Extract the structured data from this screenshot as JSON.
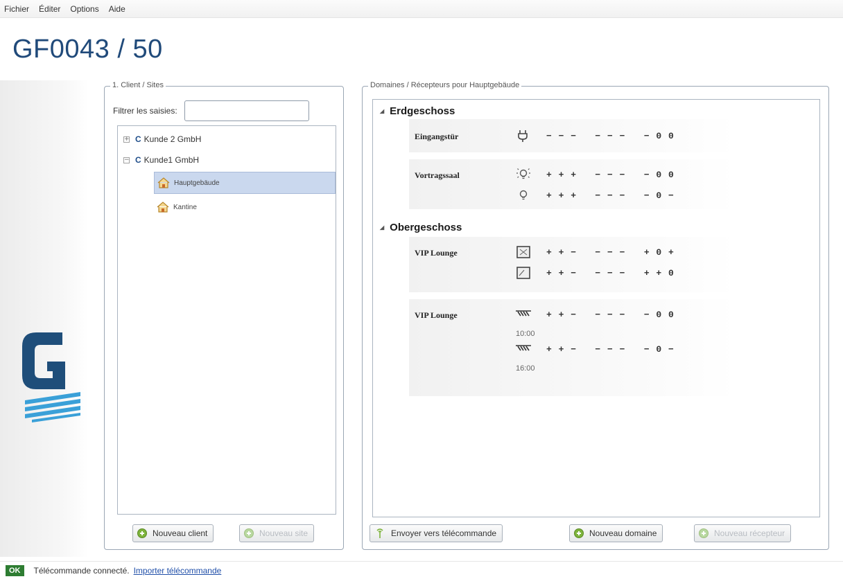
{
  "menu": [
    "Fichier",
    "Éditer",
    "Options",
    "Aide"
  ],
  "title": "GF0043 / 50",
  "colors": {
    "title": "#204a7a",
    "ok_badge": "#2e7d32",
    "link": "#1f4ea8",
    "selection": "#cad8ee",
    "logo_blue": "#1f4e7a",
    "logo_stripes": "#3aa0d8"
  },
  "clients_group": {
    "title": "1. Client / Sites",
    "filter_label": "Filtrer les saisies:",
    "filter_value": "",
    "tree": [
      {
        "expander": "+",
        "prefix": "C",
        "label": "Kunde 2 GmbH"
      },
      {
        "expander": "−",
        "prefix": "C",
        "label": "Kunde1 GmbH",
        "sites": [
          {
            "label": "Hauptgebäude",
            "selected": true,
            "icon": "house-icon"
          },
          {
            "label": "Kantine",
            "selected": false,
            "icon": "house-icon"
          }
        ]
      }
    ],
    "buttons": {
      "new_client": "Nouveau client",
      "new_site": "Nouveau site"
    }
  },
  "domains_group": {
    "title": "Domaines / Récepteurs pour Hauptgebäude",
    "floors": [
      {
        "name": "Erdgeschoss",
        "rooms": [
          {
            "name": "Eingangstür",
            "receivers": [
              {
                "icon": "plug-icon",
                "values": "− − −   − − −   − 0 0"
              }
            ]
          },
          {
            "name": "Vortragssaal",
            "receivers": [
              {
                "icon": "bulb-on-icon",
                "values": "+ + +   − − −   − 0 0"
              },
              {
                "icon": "bulb-icon",
                "values": "+ + +   − − −   − 0 −"
              }
            ]
          }
        ]
      },
      {
        "name": "Obergeschoss",
        "rooms": [
          {
            "name": "VIP Lounge",
            "receivers": [
              {
                "icon": "window-open-icon",
                "values": "+ + −   − − −   + 0 +"
              },
              {
                "icon": "window-icon",
                "values": "+ + −   − − −   + + 0"
              }
            ]
          },
          {
            "name": "VIP Lounge",
            "receivers": [
              {
                "icon": "blind-icon",
                "values": "+ + −   − − −   − 0 0",
                "time": "10:00"
              },
              {
                "icon": "blind-icon",
                "values": "+ + −   − − −   − 0 −",
                "time": "16:00"
              }
            ]
          }
        ]
      }
    ],
    "buttons": {
      "send_remote": "Envoyer vers télécommande",
      "new_domain": "Nouveau domaine",
      "new_receiver": "Nouveau récepteur"
    }
  },
  "status": {
    "badge": "OK",
    "text": "Télécommande connecté.",
    "link": "Importer télécommande"
  }
}
